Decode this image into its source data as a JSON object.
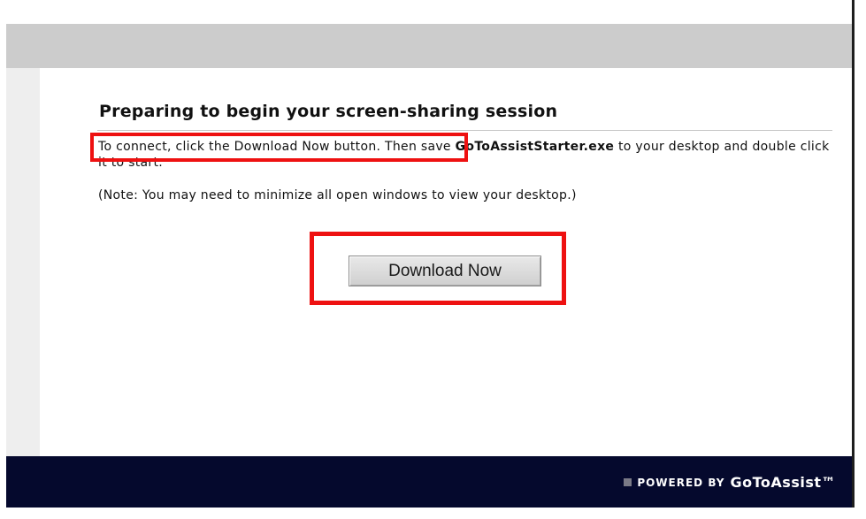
{
  "page": {
    "heading": "Preparing to begin your screen-sharing session",
    "instruction_part1": "To connect, click the Download Now button.",
    "instruction_part2": " Then save ",
    "filename": "GoToAssistStarter.exe",
    "instruction_part3": " to your desktop and double click it to start.",
    "note": "(Note: You may need to minimize all open windows to view your desktop.)",
    "download_button_label": "Download Now"
  },
  "footer": {
    "powered_by": "POWERED BY",
    "brand": "GoToAssist™"
  },
  "colors": {
    "highlight": "#ee1111",
    "footer_bg": "#05092d",
    "top_bar": "#cccccc"
  }
}
